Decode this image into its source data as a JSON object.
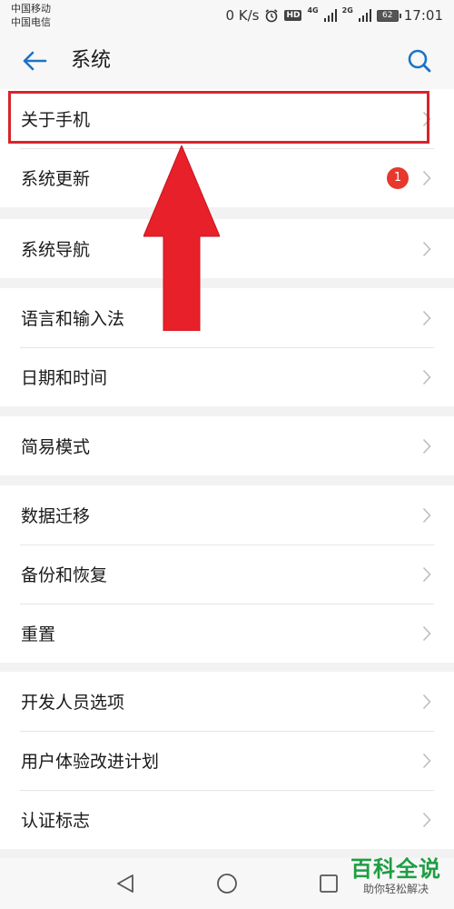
{
  "status_bar": {
    "carrier_1": "中国移动",
    "carrier_2": "中国电信",
    "net_speed": "0 K/s",
    "hd_label": "HD",
    "sim1_net": "4G",
    "sim2_net": "2G",
    "battery": "62",
    "time": "17:01",
    "icons": [
      "alarm-icon",
      "signal-icon",
      "battery-icon"
    ]
  },
  "header": {
    "title": "系统",
    "back_icon": "back-arrow-icon",
    "search_icon": "search-icon"
  },
  "groups": [
    {
      "items": [
        {
          "label": "关于手机"
        },
        {
          "label": "系统更新",
          "badge": "1"
        }
      ]
    },
    {
      "items": [
        {
          "label": "系统导航"
        }
      ]
    },
    {
      "items": [
        {
          "label": "语言和输入法"
        },
        {
          "label": "日期和时间"
        }
      ]
    },
    {
      "items": [
        {
          "label": "简易模式"
        }
      ]
    },
    {
      "items": [
        {
          "label": "数据迁移"
        },
        {
          "label": "备份和恢复"
        },
        {
          "label": "重置"
        }
      ]
    },
    {
      "items": [
        {
          "label": "开发人员选项"
        },
        {
          "label": "用户体验改进计划"
        },
        {
          "label": "认证标志"
        }
      ]
    }
  ],
  "nav_bar": {
    "icons": [
      "back-triangle-icon",
      "home-circle-icon",
      "recents-square-icon"
    ]
  },
  "watermark": {
    "title": "百科全说",
    "subtitle": "助你轻松解决"
  },
  "colors": {
    "accent": "#1a73c8",
    "badge": "#e8372b",
    "annotation": "#d8242c",
    "watermark": "#1e9e43"
  }
}
